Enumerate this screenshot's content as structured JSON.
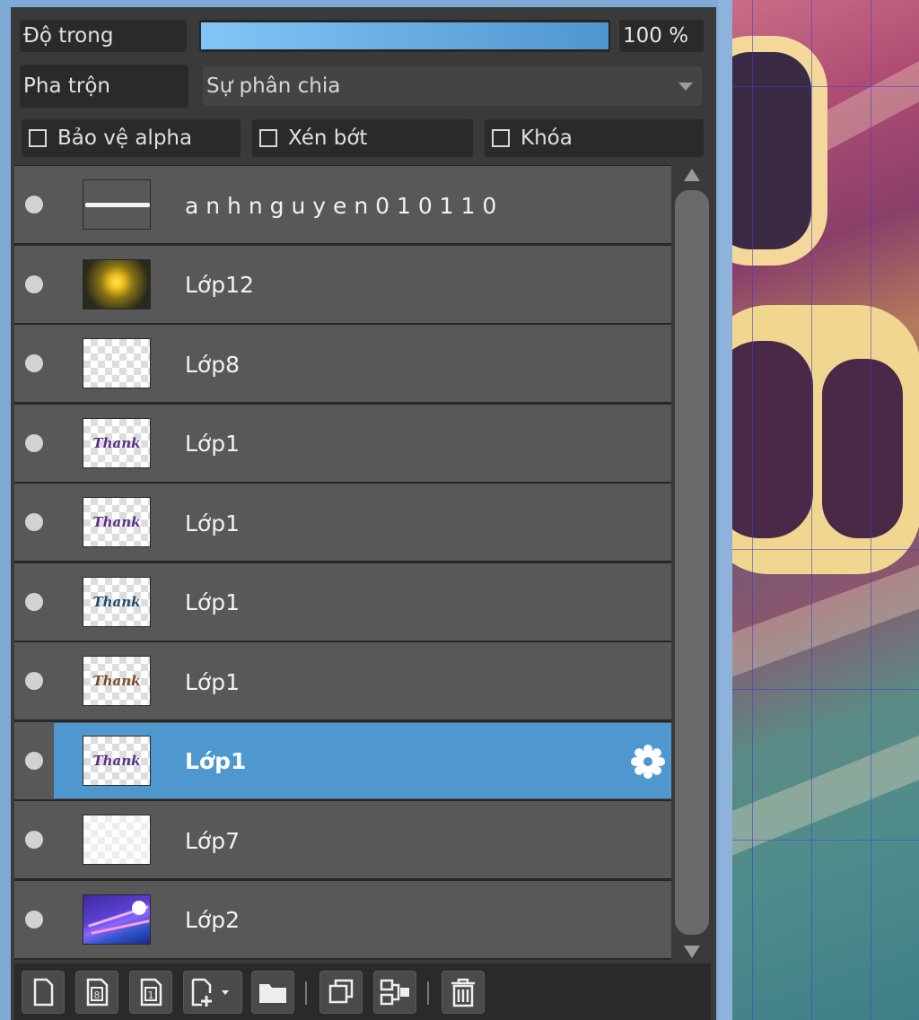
{
  "panel": {
    "opacity_label": "Độ trong",
    "opacity_value": "100 %",
    "opacity_fraction": 1.0,
    "blend_label": "Pha trộn",
    "blend_value": "Sự phân chia",
    "checkboxes": [
      {
        "label": "Bảo vệ alpha",
        "checked": false
      },
      {
        "label": "Xén bớt",
        "checked": false
      },
      {
        "label": "Khóa",
        "checked": false
      }
    ]
  },
  "layers": [
    {
      "name": "a n h n g u y e n 0 1 0 1 1 0",
      "thumb": "signature-strip",
      "selected": false
    },
    {
      "name": "Lớp12",
      "thumb": "yellow-glow",
      "selected": false
    },
    {
      "name": "Lớp8",
      "thumb": "transparent",
      "selected": false
    },
    {
      "name": "Lớp1",
      "thumb": "script-purple",
      "selected": false
    },
    {
      "name": "Lớp1",
      "thumb": "script-purple",
      "selected": false
    },
    {
      "name": "Lớp1",
      "thumb": "script-navy",
      "selected": false
    },
    {
      "name": "Lớp1",
      "thumb": "script-brown",
      "selected": false
    },
    {
      "name": "Lớp1",
      "thumb": "script-purple",
      "selected": true
    },
    {
      "name": "Lớp7",
      "thumb": "transparent-faint",
      "selected": false
    },
    {
      "name": "Lớp2",
      "thumb": "blue-light-streaks",
      "selected": false
    }
  ],
  "thumb_script_text": "Thank",
  "toolbar": {
    "buttons": [
      "new-layer-icon",
      "new-8bit-layer-icon",
      "new-1bit-layer-icon",
      "add-layer-dropdown-icon",
      "new-folder-icon",
      "duplicate-layer-icon",
      "merge-down-icon",
      "delete-layer-icon"
    ]
  },
  "colors": {
    "selection": "#4f98cf",
    "row_bg": "#585858",
    "panel_bg": "#3a3a3a",
    "frame": "#7fa9d6"
  }
}
